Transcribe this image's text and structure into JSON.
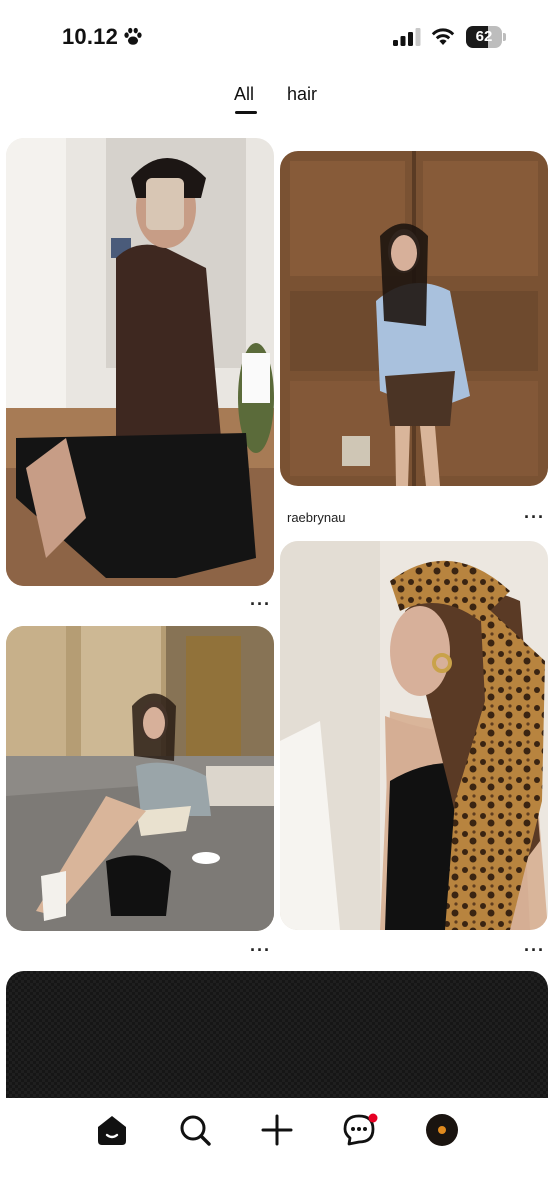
{
  "status_bar": {
    "time": "10.12",
    "battery": "62",
    "icons": [
      "paw-icon",
      "signal-icon",
      "wifi-icon",
      "battery-icon"
    ]
  },
  "tabs": [
    {
      "label": "All",
      "active": true
    },
    {
      "label": "hair",
      "active": false
    }
  ],
  "pins": [
    {
      "name": "mirror-selfie-photo",
      "more_label": "···"
    },
    {
      "name": "wooden-door-photo",
      "user": "raebrynau",
      "more_label": "···"
    },
    {
      "name": "columns-street-photo",
      "more_label": "···"
    },
    {
      "name": "leopard-scarf-photo",
      "more_label": "···"
    },
    {
      "name": "dark-textured-photo"
    }
  ],
  "bottom_nav": {
    "items": [
      "home-icon",
      "search-icon",
      "plus-icon",
      "messages-icon",
      "profile-avatar"
    ],
    "notification_color": "#e60023"
  }
}
